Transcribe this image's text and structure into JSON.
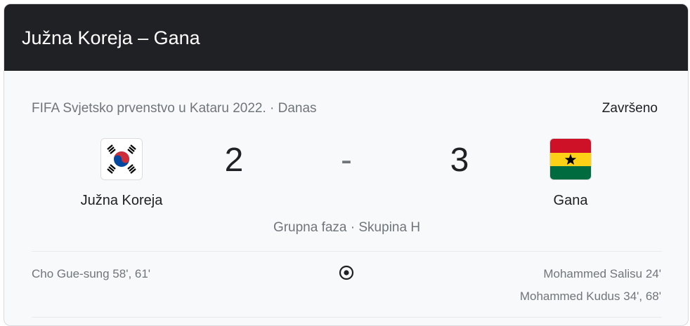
{
  "header": {
    "title": "Južna Koreja – Gana"
  },
  "match": {
    "competition": "FIFA Svjetsko prvenstvo u Kataru 2022. · Danas",
    "status": "Završeno",
    "home": {
      "name": "Južna Koreja",
      "score": "2",
      "flag_icon": "south-korea-flag-icon"
    },
    "away": {
      "name": "Gana",
      "score": "3",
      "flag_icon": "ghana-flag-icon"
    },
    "separator": "-",
    "stage": "Grupna faza · Skupina H"
  },
  "goals": {
    "icon": "soccer-ball-icon",
    "home": [
      "Cho Gue-sung 58', 61'"
    ],
    "away": [
      "Mohammed Salisu 24'",
      "Mohammed Kudus 34', 68'"
    ]
  },
  "colors": {
    "header_bg": "#202124",
    "card_bg": "#f8f9fa",
    "text_primary": "#202124",
    "text_secondary": "#70757a",
    "korea_red": "#cd2e3a",
    "korea_blue": "#0047a0",
    "ghana_red": "#ce1126",
    "ghana_gold": "#fcd116",
    "ghana_green": "#006b3f"
  }
}
